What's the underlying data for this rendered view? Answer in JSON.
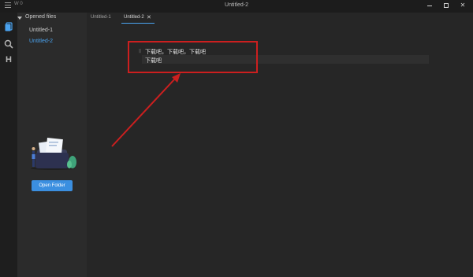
{
  "titlebar": {
    "word_count": "W 0",
    "title": "Untitled-2",
    "minimize_label": "",
    "close_label": "✕"
  },
  "sidebar": {
    "section_title": "Opened files",
    "files": [
      "Untitled-1",
      "Untitled-2"
    ],
    "open_folder_label": "Open Folder",
    "activity_outline_glyph": "H"
  },
  "tabs": [
    {
      "label": "Untitled-1"
    },
    {
      "label": "Untitled-2",
      "close": "✕"
    }
  ],
  "editor": {
    "gutter_mark": "‖",
    "lines": [
      "下载吧，下载吧，下载吧",
      "下载吧"
    ]
  },
  "colors": {
    "accent": "#4aa3f0",
    "button": "#3b8fe0",
    "annotation": "#cc1f1f"
  }
}
